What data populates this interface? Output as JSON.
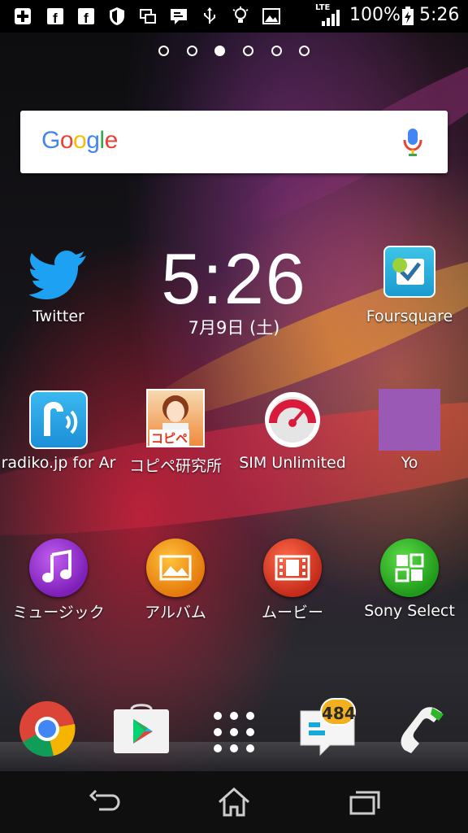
{
  "status_bar": {
    "network": "LTE",
    "battery": "100%",
    "time": "5:26",
    "notification_icons": [
      "plus-box-icon",
      "facebook-icon",
      "facebook-icon",
      "shield-icon",
      "screens-icon",
      "message-icon",
      "usb-icon",
      "lightbulb-icon",
      "image-icon"
    ]
  },
  "page_indicator": {
    "count": 6,
    "active_index": 2
  },
  "search": {
    "logo": "Google",
    "icon": "mic-icon"
  },
  "clock": {
    "time": "5:26",
    "date": "7月9日 (土)"
  },
  "apps_row1": [
    {
      "label": "Twitter",
      "icon": "twitter-bird-icon"
    },
    {
      "label": "Foursquare",
      "icon": "foursquare-icon"
    }
  ],
  "apps_row2": [
    {
      "label": "radiko.jp for Ar",
      "icon": "radiko-icon"
    },
    {
      "label": "コピペ研究所",
      "icon": "kopipe-icon",
      "icon_text": "コピペ"
    },
    {
      "label": "SIM Unlimited",
      "icon": "speedometer-icon"
    },
    {
      "label": "Yo",
      "icon": "purple-square-icon"
    }
  ],
  "apps_row3": [
    {
      "label": "ミュージック",
      "icon": "music-note-icon"
    },
    {
      "label": "アルバム",
      "icon": "album-photo-icon"
    },
    {
      "label": "ムービー",
      "icon": "film-strip-icon"
    },
    {
      "label": "Sony Select",
      "icon": "sony-select-icon"
    }
  ],
  "dock": [
    {
      "name": "chrome",
      "icon": "chrome-icon"
    },
    {
      "name": "play-store",
      "icon": "play-store-icon"
    },
    {
      "name": "app-drawer",
      "icon": "app-grid-icon"
    },
    {
      "name": "messages",
      "icon": "message-bubble-icon",
      "badge": "484"
    },
    {
      "name": "phone",
      "icon": "phone-handset-icon"
    }
  ],
  "navbar": [
    "back-icon",
    "home-icon",
    "recents-icon"
  ],
  "colors": {
    "twitter_blue": "#1da1f2",
    "music_purple": "#8e2cc9",
    "album_orange": "#f08a12",
    "movie_red": "#e0402a",
    "sony_green": "#2fb52a",
    "yo_purple": "#9b59b6",
    "badge_yellow": "#f2b01e"
  }
}
